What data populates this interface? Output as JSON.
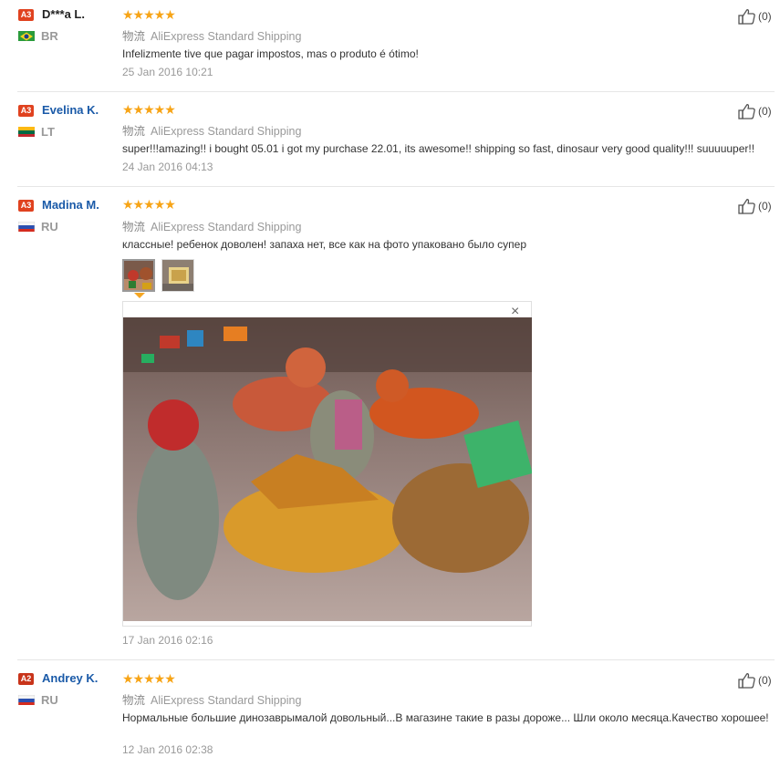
{
  "reviews": [
    {
      "level": "A3",
      "name": "D***a L.",
      "country": "BR",
      "stars": "★★★★★",
      "shipping_label": "物流",
      "shipping": "AliExpress Standard Shipping",
      "text": "Infelizmente tive que pagar impostos, mas o produto é ótimo!",
      "date": "25 Jan 2016 10:21",
      "helpful": "(0)"
    },
    {
      "level": "A3",
      "name": "Evelina K.",
      "country": "LT",
      "stars": "★★★★★",
      "shipping_label": "物流",
      "shipping": "AliExpress Standard Shipping",
      "text": "super!!!amazing!! i bought 05.01 i got my purchase 22.01, its awesome!! shipping so fast, dinosaur very good quality!!! suuuuuper!!",
      "date": "24 Jan 2016 04:13",
      "helpful": "(0)"
    },
    {
      "level": "A3",
      "name": "Madina M.",
      "country": "RU",
      "stars": "★★★★★",
      "shipping_label": "物流",
      "shipping": "AliExpress Standard Shipping",
      "text": "классные! ребенок доволен! запаха нет, все как на фото упаковано было супер",
      "date": "17 Jan 2016 02:16",
      "helpful": "(0)"
    },
    {
      "level": "A2",
      "name": "Andrey K.",
      "country": "RU",
      "stars": "★★★★★",
      "shipping_label": "物流",
      "shipping": "AliExpress Standard Shipping",
      "text": "Нормальные большие динозаврымалой довольный...В магазине такие в разы дороже... Шли около месяца.Качество хорошее!",
      "date": "12 Jan 2016 02:38",
      "helpful": "(0)"
    }
  ],
  "viewer": {
    "close": "×"
  },
  "icons": {
    "like": "thumbs-up-icon",
    "close": "close-icon"
  },
  "colors": {
    "name_link": "#1a5aa8",
    "level_a3": "#e0421f",
    "level_a2": "#c8341a",
    "star": "#f7a416",
    "muted": "#999999"
  }
}
